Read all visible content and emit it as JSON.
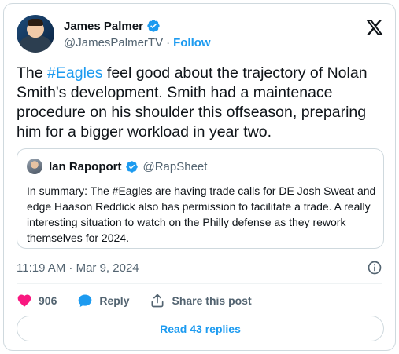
{
  "author": {
    "name": "James Palmer",
    "handle": "@JamesPalmerTV",
    "separator": "·",
    "follow_label": "Follow"
  },
  "tweet": {
    "text_before": "The ",
    "hashtag": "#Eagles",
    "text_after": " feel good about the trajectory of Nolan Smith's development. Smith had a maintenace procedure on his shoulder this offseason, preparing him for a bigger workload in year two."
  },
  "quote": {
    "name": "Ian Rapoport",
    "handle": "@RapSheet",
    "text": "In summary: The #Eagles are having trade calls for DE Josh Sweat and edge Haason Reddick also has permission to facilitate a trade. A really interesting situation to watch on the Philly defense as they rework themselves for 2024."
  },
  "meta": {
    "timestamp": "11:19 AM · Mar 9, 2024"
  },
  "actions": {
    "like_count": "906",
    "reply_label": "Reply",
    "share_label": "Share this post"
  },
  "read_replies_label": "Read 43 replies",
  "colors": {
    "accent": "#1d9bf0",
    "like": "#f91880",
    "text": "#0f1419",
    "secondary": "#536471",
    "border": "#cfd9de"
  },
  "icons": [
    "verified-badge-icon",
    "x-logo-icon",
    "info-icon",
    "heart-icon",
    "reply-bubble-icon",
    "share-icon"
  ]
}
